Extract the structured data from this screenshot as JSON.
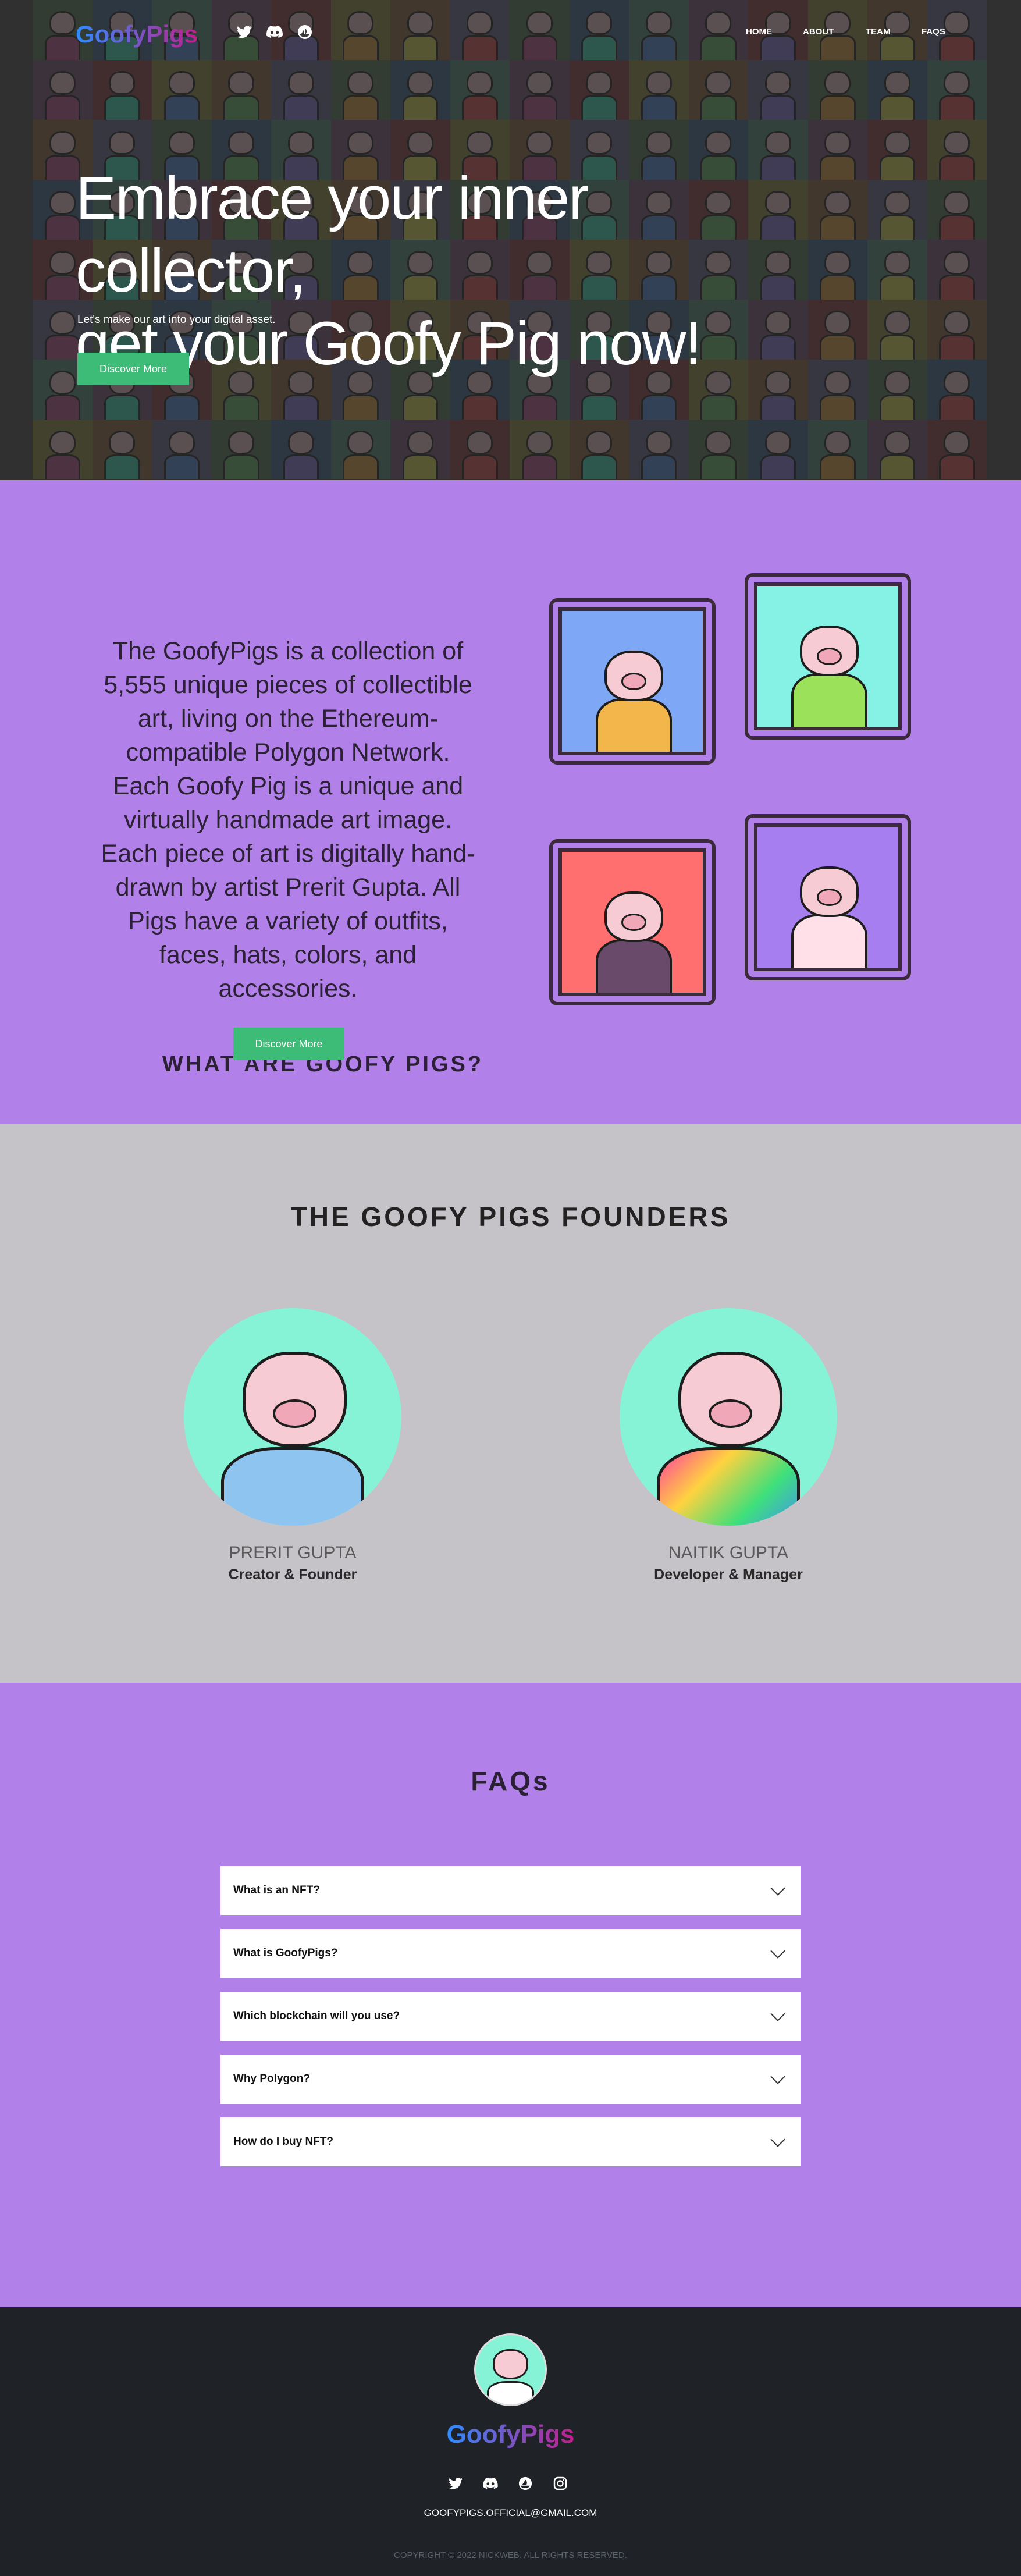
{
  "nav": {
    "logo": "GoofyPigs",
    "socials": [
      "twitter-icon",
      "discord-icon",
      "opensea-icon"
    ],
    "links": [
      "HOME",
      "ABOUT",
      "TEAM",
      "FAQS"
    ]
  },
  "hero": {
    "title_line1": "Embrace your inner collector,",
    "title_line2": "get your Goofy Pig now!",
    "subtitle": "Let's make our art into your digital asset.",
    "button": "Discover More"
  },
  "about": {
    "title": "WHAT ARE GOOFY PIGS?",
    "text": "The GoofyPigs is a collection of 5,555 unique pieces of collectible art, living on the Ethereum-compatible Polygon Network. Each Goofy Pig is a unique and virtually handmade art image. Each piece of art is digitally hand-drawn by artist Prerit Gupta. All Pigs have a variety of outfits, faces, hats, colors, and accessories.",
    "button": "Discover More",
    "frames": [
      {
        "bg": "#7ea8f5",
        "body": "#f3b64a"
      },
      {
        "bg": "#86f2e6",
        "body": "#9be25a"
      },
      {
        "bg": "#ff6f6f",
        "body": "#6a4a6a"
      },
      {
        "bg": "#a77ef0",
        "body": "#ffe0e8"
      }
    ]
  },
  "founders": {
    "title": "THE GOOFY PIGS FOUNDERS",
    "people": [
      {
        "name": "PRERIT GUPTA",
        "role": "Creator & Founder"
      },
      {
        "name": "NAITIK GUPTA",
        "role": "Developer & Manager"
      }
    ]
  },
  "faq": {
    "title": "FAQs",
    "items": [
      "What is an NFT?",
      "What is GoofyPigs?",
      "Which blockchain will you use?",
      "Why Polygon?",
      "How do I buy NFT?"
    ]
  },
  "footer": {
    "logo": "GoofyPigs",
    "socials": [
      "twitter-icon",
      "discord-icon",
      "opensea-icon",
      "instagram-icon"
    ],
    "email": "GOOFYPIGS.OFFICIAL@GMAIL.COM",
    "copyright": "COPYRIGHT © 2022 NICKWEB. ALL RIGHTS RESERVED."
  },
  "colors": {
    "accent_green": "#3cbc77",
    "purple": "#b180e8",
    "grey": "#c6c3c8",
    "footer_bg": "#1f2227",
    "logo_gradient": [
      "#2f8cff",
      "#c21f8c"
    ]
  }
}
